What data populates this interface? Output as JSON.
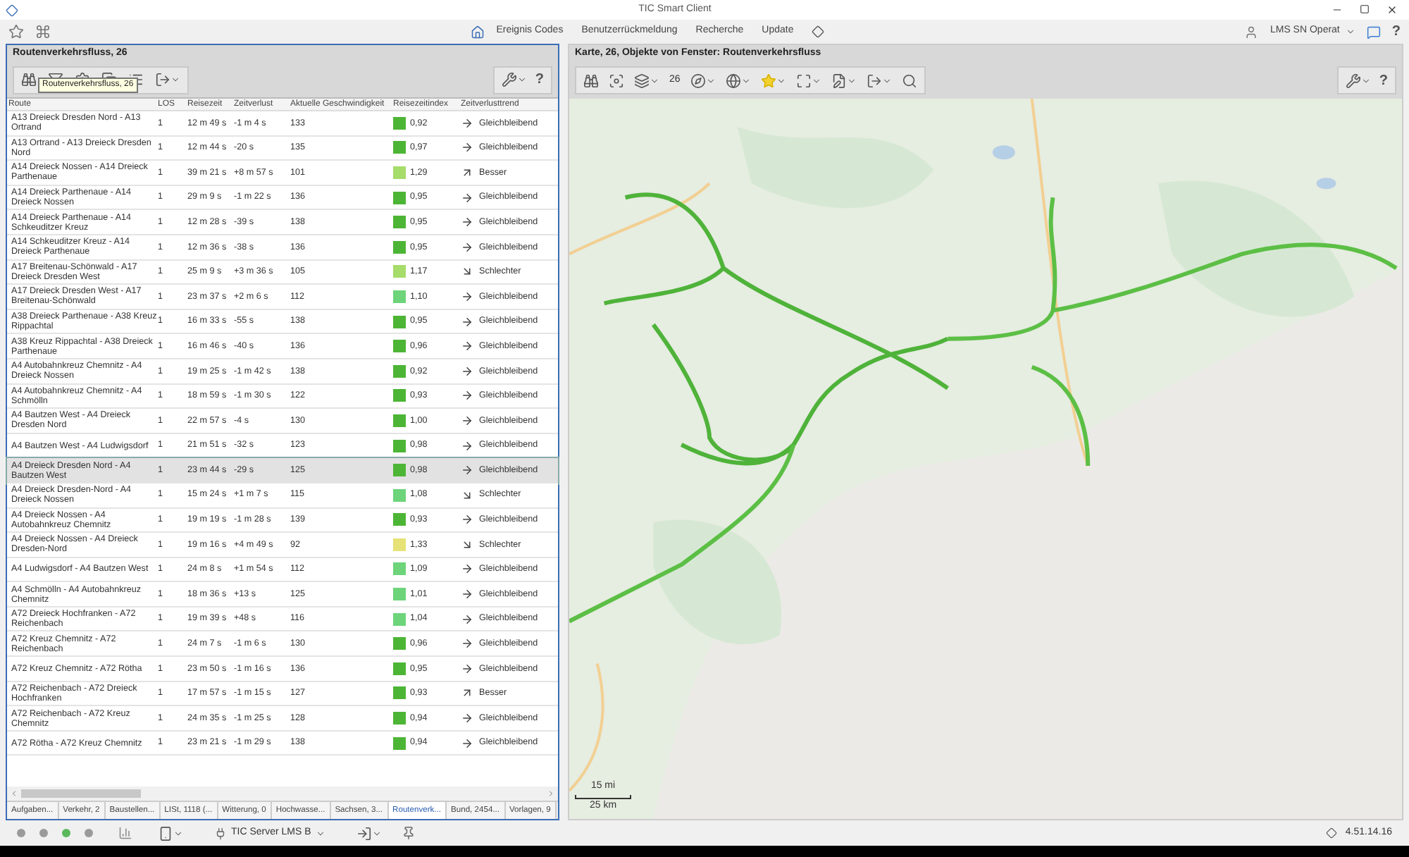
{
  "window": {
    "title": "TIC Smart Client"
  },
  "topbar": {
    "nav": [
      "Ereignis Codes",
      "Benutzerrückmeldung",
      "Recherche",
      "Update"
    ],
    "user": "LMS SN Operat",
    "help": "?"
  },
  "left_panel": {
    "title": "Routenverkehrsfluss, 26",
    "tooltip": "Routenverkehrsfluss, 26",
    "help": "?",
    "columns": [
      "Route",
      "LOS",
      "Reisezeit",
      "Zeitverlust",
      "Aktuelle Geschwindigkeit",
      "Reisezeitindex",
      "Zeitverlusttrend"
    ],
    "rows": [
      {
        "route": "A13 Dreieck Dresden Nord - A13 Ortrand",
        "los": "1",
        "time": "12 m 49 s",
        "loss": "-1 m 4 s",
        "speed": "133",
        "index": "0,92",
        "color": "#4db535",
        "trend": "Gleichbleibend",
        "kind": "same",
        "selected": false
      },
      {
        "route": "A13 Ortrand - A13 Dreieck Dresden Nord",
        "los": "1",
        "time": "12 m 44 s",
        "loss": "-20 s",
        "speed": "135",
        "index": "0,97",
        "color": "#4db535",
        "trend": "Gleichbleibend",
        "kind": "same",
        "selected": false
      },
      {
        "route": "A14 Dreieck Nossen - A14 Dreieck Parthenaue",
        "los": "1",
        "time": "39 m 21 s",
        "loss": "+8 m 57 s",
        "speed": "101",
        "index": "1,29",
        "color": "#a6dc6a",
        "trend": "Besser",
        "kind": "better",
        "selected": false
      },
      {
        "route": "A14 Dreieck Parthenaue - A14 Dreieck Nossen",
        "los": "1",
        "time": "29 m 9 s",
        "loss": "-1 m 22 s",
        "speed": "136",
        "index": "0,95",
        "color": "#4db535",
        "trend": "Gleichbleibend",
        "kind": "same",
        "selected": false
      },
      {
        "route": "A14 Dreieck Parthenaue - A14 Schkeuditzer Kreuz",
        "los": "1",
        "time": "12 m 28 s",
        "loss": "-39 s",
        "speed": "138",
        "index": "0,95",
        "color": "#4db535",
        "trend": "Gleichbleibend",
        "kind": "same",
        "selected": false
      },
      {
        "route": "A14 Schkeuditzer Kreuz - A14 Dreieck Parthenaue",
        "los": "1",
        "time": "12 m 36 s",
        "loss": "-38 s",
        "speed": "136",
        "index": "0,95",
        "color": "#4db535",
        "trend": "Gleichbleibend",
        "kind": "same",
        "selected": false
      },
      {
        "route": "A17 Breitenau-Schönwald - A17 Dreieck Dresden West",
        "los": "1",
        "time": "25 m 9 s",
        "loss": "+3 m 36 s",
        "speed": "105",
        "index": "1,17",
        "color": "#a6dc6a",
        "trend": "Schlechter",
        "kind": "worse",
        "selected": false
      },
      {
        "route": "A17 Dreieck Dresden West - A17 Breitenau-Schönwald",
        "los": "1",
        "time": "23 m 37 s",
        "loss": "+2 m 6 s",
        "speed": "112",
        "index": "1,10",
        "color": "#6dd47a",
        "trend": "Gleichbleibend",
        "kind": "same",
        "selected": false
      },
      {
        "route": "A38 Dreieck Parthenaue - A38 Kreuz Rippachtal",
        "los": "1",
        "time": "16 m 33 s",
        "loss": "-55 s",
        "speed": "138",
        "index": "0,95",
        "color": "#4db535",
        "trend": "Gleichbleibend",
        "kind": "same",
        "selected": false
      },
      {
        "route": "A38 Kreuz Rippachtal - A38 Dreieck Parthenaue",
        "los": "1",
        "time": "16 m 46 s",
        "loss": "-40 s",
        "speed": "136",
        "index": "0,96",
        "color": "#4db535",
        "trend": "Gleichbleibend",
        "kind": "same",
        "selected": false
      },
      {
        "route": "A4 Autobahnkreuz Chemnitz - A4 Dreieck Nossen",
        "los": "1",
        "time": "19 m 25 s",
        "loss": "-1 m 42 s",
        "speed": "138",
        "index": "0,92",
        "color": "#4db535",
        "trend": "Gleichbleibend",
        "kind": "same",
        "selected": false
      },
      {
        "route": "A4 Autobahnkreuz Chemnitz - A4 Schmölln",
        "los": "1",
        "time": "18 m 59 s",
        "loss": "-1 m 30 s",
        "speed": "122",
        "index": "0,93",
        "color": "#4db535",
        "trend": "Gleichbleibend",
        "kind": "same",
        "selected": false
      },
      {
        "route": "A4 Bautzen West - A4 Dreieck Dresden Nord",
        "los": "1",
        "time": "22 m 57 s",
        "loss": "-4 s",
        "speed": "130",
        "index": "1,00",
        "color": "#4db535",
        "trend": "Gleichbleibend",
        "kind": "same",
        "selected": false
      },
      {
        "route": "A4 Bautzen West - A4 Ludwigsdorf",
        "los": "1",
        "time": "21 m 51 s",
        "loss": "-32 s",
        "speed": "123",
        "index": "0,98",
        "color": "#4db535",
        "trend": "Gleichbleibend",
        "kind": "same",
        "selected": false
      },
      {
        "route": "A4 Dreieck Dresden Nord - A4 Bautzen West",
        "los": "1",
        "time": "23 m 44 s",
        "loss": "-29 s",
        "speed": "125",
        "index": "0,98",
        "color": "#4db535",
        "trend": "Gleichbleibend",
        "kind": "same",
        "selected": true
      },
      {
        "route": "A4 Dreieck Dresden-Nord - A4 Dreieck Nossen",
        "los": "1",
        "time": "15 m 24 s",
        "loss": "+1 m 7 s",
        "speed": "115",
        "index": "1,08",
        "color": "#6dd47a",
        "trend": "Schlechter",
        "kind": "worse",
        "selected": false
      },
      {
        "route": "A4 Dreieck Nossen - A4 Autobahnkreuz Chemnitz",
        "los": "1",
        "time": "19 m 19 s",
        "loss": "-1 m 28 s",
        "speed": "139",
        "index": "0,93",
        "color": "#4db535",
        "trend": "Gleichbleibend",
        "kind": "same",
        "selected": false
      },
      {
        "route": "A4 Dreieck Nossen - A4 Dreieck Dresden-Nord",
        "los": "1",
        "time": "19 m 16 s",
        "loss": "+4 m 49 s",
        "speed": "92",
        "index": "1,33",
        "color": "#e6e277",
        "trend": "Schlechter",
        "kind": "worse",
        "selected": false
      },
      {
        "route": "A4 Ludwigsdorf - A4 Bautzen West",
        "los": "1",
        "time": "24 m 8 s",
        "loss": "+1 m 54 s",
        "speed": "112",
        "index": "1,09",
        "color": "#6dd47a",
        "trend": "Gleichbleibend",
        "kind": "same",
        "selected": false
      },
      {
        "route": "A4 Schmölln - A4 Autobahnkreuz Chemnitz",
        "los": "1",
        "time": "18 m 36 s",
        "loss": "+13 s",
        "speed": "125",
        "index": "1,01",
        "color": "#6dd47a",
        "trend": "Gleichbleibend",
        "kind": "same",
        "selected": false
      },
      {
        "route": "A72 Dreieck Hochfranken - A72 Reichenbach",
        "los": "1",
        "time": "19 m 39 s",
        "loss": "+48 s",
        "speed": "116",
        "index": "1,04",
        "color": "#6dd47a",
        "trend": "Gleichbleibend",
        "kind": "same",
        "selected": false
      },
      {
        "route": "A72 Kreuz Chemnitz - A72 Reichenbach",
        "los": "1",
        "time": "24 m 7 s",
        "loss": "-1 m 6 s",
        "speed": "130",
        "index": "0,96",
        "color": "#4db535",
        "trend": "Gleichbleibend",
        "kind": "same",
        "selected": false
      },
      {
        "route": "A72 Kreuz Chemnitz - A72 Rötha",
        "los": "1",
        "time": "23 m 50 s",
        "loss": "-1 m 16 s",
        "speed": "136",
        "index": "0,95",
        "color": "#4db535",
        "trend": "Gleichbleibend",
        "kind": "same",
        "selected": false
      },
      {
        "route": "A72  Reichenbach - A72 Dreieck Hochfranken",
        "los": "1",
        "time": "17 m 57 s",
        "loss": "-1 m 15 s",
        "speed": "127",
        "index": "0,93",
        "color": "#4db535",
        "trend": "Besser",
        "kind": "better",
        "selected": false
      },
      {
        "route": "A72 Reichenbach - A72 Kreuz Chemnitz",
        "los": "1",
        "time": "24 m 35 s",
        "loss": "-1 m 25 s",
        "speed": "128",
        "index": "0,94",
        "color": "#4db535",
        "trend": "Gleichbleibend",
        "kind": "same",
        "selected": false
      },
      {
        "route": "A72 Rötha - A72 Kreuz Chemnitz",
        "los": "1",
        "time": "23 m 21 s",
        "loss": "-1 m 29 s",
        "speed": "138",
        "index": "0,94",
        "color": "#4db535",
        "trend": "Gleichbleibend",
        "kind": "same",
        "selected": false
      }
    ],
    "tabs": [
      {
        "label": "Aufgaben...",
        "selected": false
      },
      {
        "label": "Verkehr, 2",
        "selected": false
      },
      {
        "label": "Baustellen...",
        "selected": false
      },
      {
        "label": "LISt, 1118 (...",
        "selected": false
      },
      {
        "label": "Witterung, 0",
        "selected": false
      },
      {
        "label": "Hochwasse...",
        "selected": false
      },
      {
        "label": "Sachsen, 3...",
        "selected": false
      },
      {
        "label": "Routenverk...",
        "selected": true
      },
      {
        "label": "Bund, 2454...",
        "selected": false
      },
      {
        "label": "Vorlagen, 9",
        "selected": false
      }
    ]
  },
  "right_panel": {
    "title": "Karte, 26, Objekte von Fenster: Routenverkehrsfluss",
    "count": "26",
    "help": "?",
    "map": {
      "kind": "picture",
      "scale": [
        "15 mi",
        "25 km"
      ]
    }
  },
  "status_bar": {
    "dots": [
      {
        "color": "#9a9a9a"
      },
      {
        "color": "#9a9a9a"
      },
      {
        "color": "#5cb85c"
      },
      {
        "color": "#9a9a9a"
      }
    ],
    "server": "TIC Server LMS B",
    "version": "4.51.14.16"
  }
}
